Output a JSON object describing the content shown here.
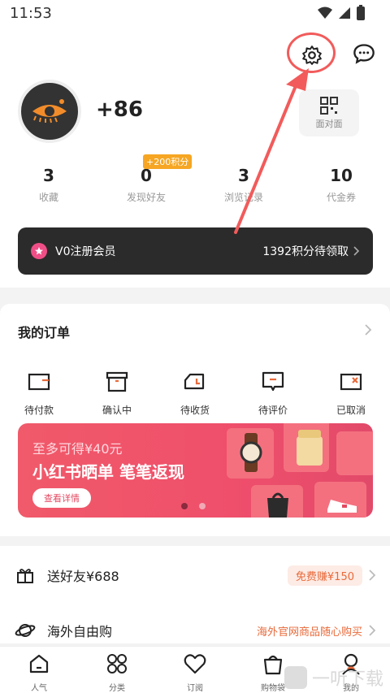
{
  "status_bar": {
    "time": "11:53"
  },
  "profile": {
    "phone": "+86",
    "qr_label": "面对面",
    "stats": [
      {
        "num": "3",
        "label": "收藏"
      },
      {
        "num": "0",
        "label": "发现好友",
        "badge": "+200积分"
      },
      {
        "num": "3",
        "label": "浏览记录"
      },
      {
        "num": "10",
        "label": "代金券"
      }
    ],
    "member": {
      "title": "V0注册会员",
      "right": "1392积分待领取"
    }
  },
  "orders": {
    "title": "我的订单",
    "items": [
      {
        "label": "待付款",
        "icon": "wallet-icon"
      },
      {
        "label": "确认中",
        "icon": "box-icon"
      },
      {
        "label": "待收货",
        "icon": "truck-icon"
      },
      {
        "label": "待评价",
        "icon": "comment-icon"
      },
      {
        "label": "已取消",
        "icon": "cancel-box-icon"
      }
    ],
    "banner": {
      "line1": "至多可得¥40元",
      "line2": "小红书晒单 笔笔返现",
      "button": "查看详情"
    }
  },
  "list": {
    "invite": {
      "title": "送好友¥688",
      "tag": "免费赚¥150"
    },
    "overseas": {
      "title": "海外自由购",
      "sub": "海外官网商品随心购买"
    }
  },
  "tabs": [
    {
      "label": "人气",
      "icon": "home-icon"
    },
    {
      "label": "分类",
      "icon": "grid-icon"
    },
    {
      "label": "订阅",
      "icon": "heart-icon"
    },
    {
      "label": "购物袋",
      "icon": "bag-icon"
    },
    {
      "label": "我的",
      "icon": "user-icon"
    }
  ],
  "watermark": "一听下载",
  "colors": {
    "accent": "#f25b5b",
    "member_bg": "#2b2b2b",
    "banner": "#ef4f6b",
    "badge": "#f6a623",
    "tag_text": "#e86a3a"
  }
}
